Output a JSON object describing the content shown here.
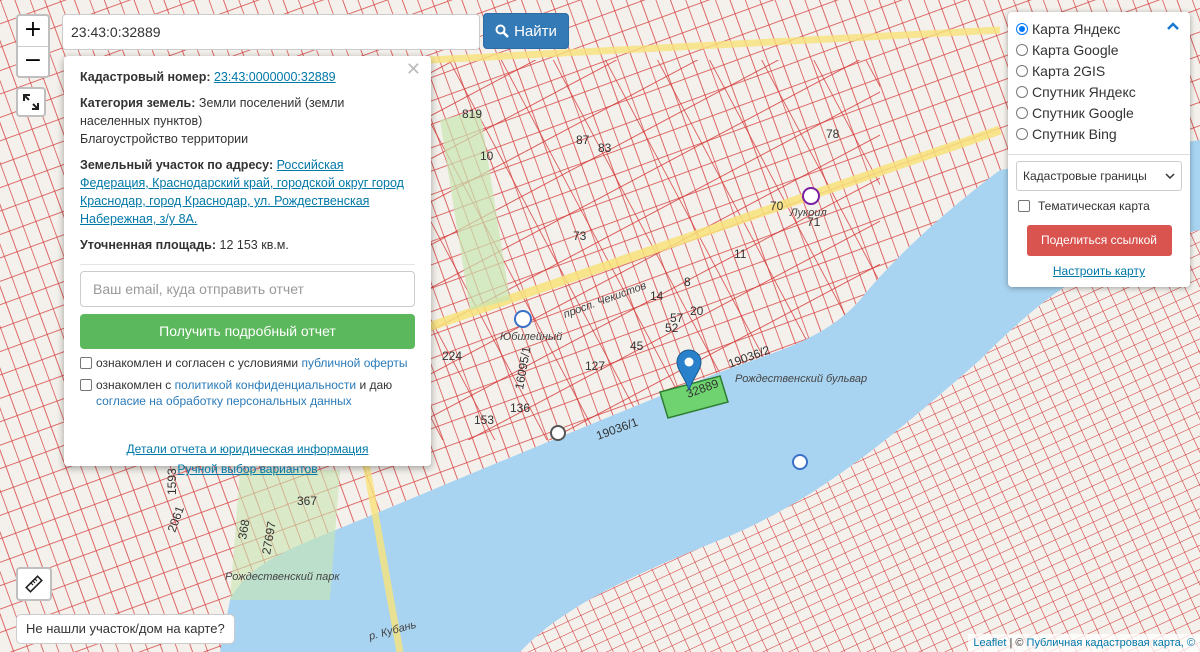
{
  "search": {
    "value": "23:43:0:32889",
    "button_label": "Найти"
  },
  "map": {
    "zoom_in": "+",
    "zoom_out": "−",
    "labels": [
      {
        "text": "819"
      },
      {
        "text": "10"
      },
      {
        "text": "87"
      },
      {
        "text": "83"
      },
      {
        "text": "73"
      },
      {
        "text": "78"
      },
      {
        "text": "71"
      },
      {
        "text": "8"
      },
      {
        "text": "20"
      },
      {
        "text": "45"
      },
      {
        "text": "127"
      },
      {
        "text": "153"
      },
      {
        "text": "136"
      },
      {
        "text": "224"
      },
      {
        "text": "367"
      },
      {
        "text": "1593"
      },
      {
        "text": "2061"
      },
      {
        "text": "11"
      },
      {
        "text": "70"
      },
      {
        "text": "57"
      },
      {
        "text": "52"
      },
      {
        "text": "14"
      },
      {
        "text": "368"
      },
      {
        "text": "27697"
      },
      {
        "text": "32889"
      },
      {
        "text": "19036/2"
      },
      {
        "text": "19036/1"
      },
      {
        "text": "16095/1"
      }
    ],
    "place_labels": [
      {
        "text": "просп. Чекистов"
      },
      {
        "text": "Рождественский бульвар"
      },
      {
        "text": "Рождественский парк"
      },
      {
        "text": "р. Кубань"
      },
      {
        "text": "Юбилейный"
      },
      {
        "text": "Лукоил"
      }
    ]
  },
  "popup": {
    "cadastral_label": "Кадастровый номер:",
    "cadastral_value": "23:43:0000000:32889",
    "category_label": "Категория земель:",
    "category_value": "Земли поселений (земли населенных пунктов)",
    "category_use": "Благоустройство территории",
    "address_label": "Земельный участок по адресу:",
    "address_value": "Российская Федерация, Краснодарский край, городской округ город Краснодар, город Краснодар, ул. Рождественская Набережная, з/у 8А.",
    "area_label": "Уточненная площадь:",
    "area_value": "12 153 кв.м.",
    "email_placeholder": "Ваш email, куда отправить отчет",
    "report_button": "Получить подробный отчет",
    "consent1_text": "ознакомлен и согласен с условиями",
    "consent1_link": "публичной оферты",
    "consent2_text": "ознакомлен с",
    "consent2_link": "политикой конфиденциальности",
    "consent2_mid": "и даю",
    "consent2_link2": "согласие на обработку персональных данных",
    "details_link": "Детали отчета и юридическая информация",
    "manual_link": "Ручной выбор вариантов"
  },
  "layers": {
    "options": [
      {
        "label": "Карта Яндекс",
        "selected": true
      },
      {
        "label": "Карта Google",
        "selected": false
      },
      {
        "label": "Карта 2GIS",
        "selected": false
      },
      {
        "label": "Спутник Яндекс",
        "selected": false
      },
      {
        "label": "Спутник Google",
        "selected": false
      },
      {
        "label": "Спутник Bing",
        "selected": false
      }
    ],
    "overlay_select": "Кадастровые границы",
    "thematic_label": "Тематическая карта",
    "share_button": "Поделиться ссылкой",
    "configure_link": "Настроить карту"
  },
  "not_found": "Не нашли участок/дом на карте?",
  "attribution": {
    "leaflet": "Leaflet",
    "sep": " | © ",
    "source": "Публичная кадастровая карта, ©"
  },
  "colors": {
    "parcel": "#d32f2f",
    "river": "#a8d4f1",
    "selected_parcel": "#6fd46f",
    "marker": "#2a81cb"
  }
}
